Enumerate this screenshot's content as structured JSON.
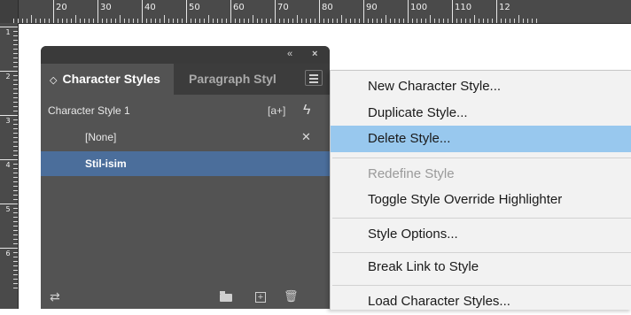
{
  "ruler": {
    "top_labels": [
      "20",
      "30",
      "40",
      "50",
      "60",
      "70",
      "80",
      "90",
      "100",
      "110",
      "12"
    ],
    "left_labels": [
      "1",
      "2",
      "3",
      "4",
      "5",
      "6"
    ]
  },
  "panel": {
    "tabs": [
      {
        "label": "Character Styles",
        "active": true
      },
      {
        "label": "Paragraph Styl",
        "active": false
      }
    ],
    "items": [
      {
        "label": "Character Style 1"
      },
      {
        "label": "[None]"
      },
      {
        "label": "Stil-isim",
        "selected": true
      }
    ],
    "icons": {
      "collapse": "«",
      "close": "×",
      "style_override": "[a+]",
      "lightning": "ϟ",
      "none_locked": "✕",
      "footer_load": "⇄",
      "footer_new": "+",
      "footer_delete": "🗑"
    }
  },
  "context_menu": {
    "items": [
      {
        "label": "New Character Style...",
        "state": "normal"
      },
      {
        "label": "Duplicate Style...",
        "state": "normal"
      },
      {
        "label": "Delete Style...",
        "state": "highlighted"
      },
      {
        "label": "Redefine Style",
        "state": "disabled"
      },
      {
        "label": "Toggle Style Override Highlighter",
        "state": "normal"
      },
      {
        "label": "Style Options...",
        "state": "normal"
      },
      {
        "label": "Break Link to Style",
        "state": "normal"
      },
      {
        "label": "Load Character Styles...",
        "state": "normal"
      }
    ]
  },
  "colors": {
    "panel_bg": "#535353",
    "selected_row": "#4b6e9b",
    "menu_highlight": "#98c8ee",
    "menu_bg": "#f2f2f2"
  }
}
